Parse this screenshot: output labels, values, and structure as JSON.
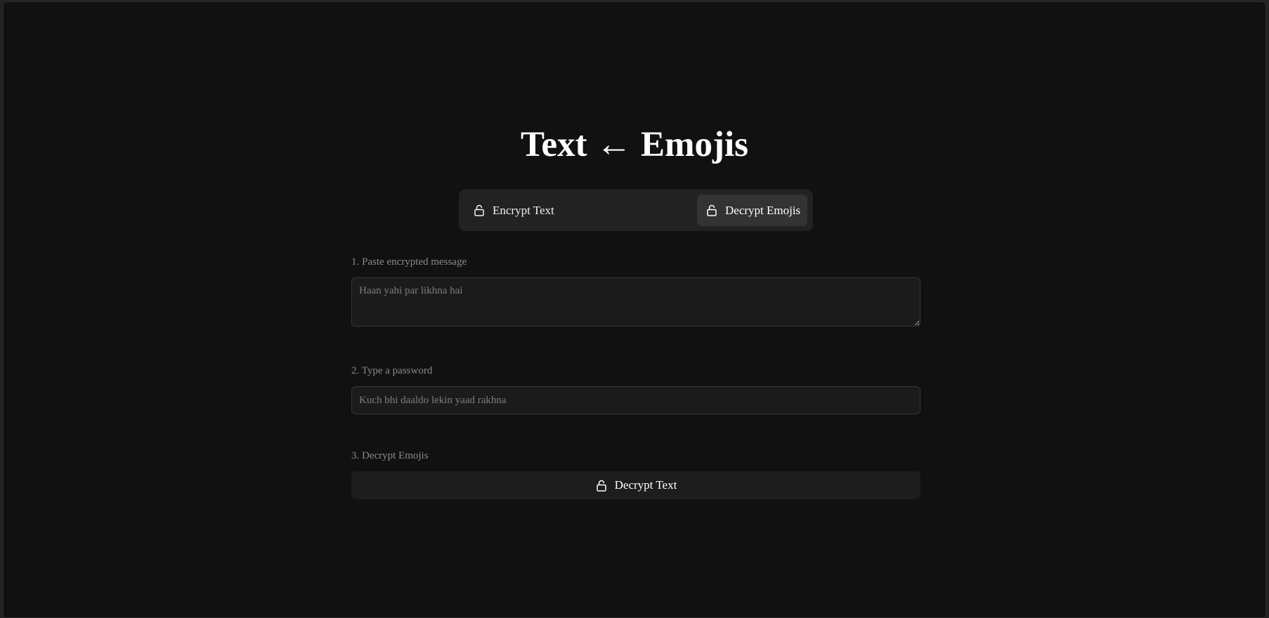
{
  "header": {
    "title": "Text ← Emojis"
  },
  "modes": {
    "encrypt_label": "Encrypt Text",
    "decrypt_label": "Decrypt Emojis",
    "active": "decrypt"
  },
  "form": {
    "message": {
      "label": "1. Paste encrypted message",
      "placeholder": "Haan yahi par likhna hai",
      "value": ""
    },
    "password": {
      "label": "2. Type a password",
      "placeholder": "Kuch bhi daaldo lekin yaad rakhna",
      "value": ""
    },
    "action": {
      "label": "3. Decrypt Emojis",
      "button_label": "Decrypt Text"
    }
  },
  "icons": {
    "mode_icon": "unlock-icon",
    "button_icon": "unlock-icon"
  },
  "colors": {
    "background": "#111111",
    "panel": "#222222",
    "active_tab": "#333333",
    "field": "#1b1b1b",
    "text": "#ffffff",
    "muted": "#8a8a8a"
  }
}
